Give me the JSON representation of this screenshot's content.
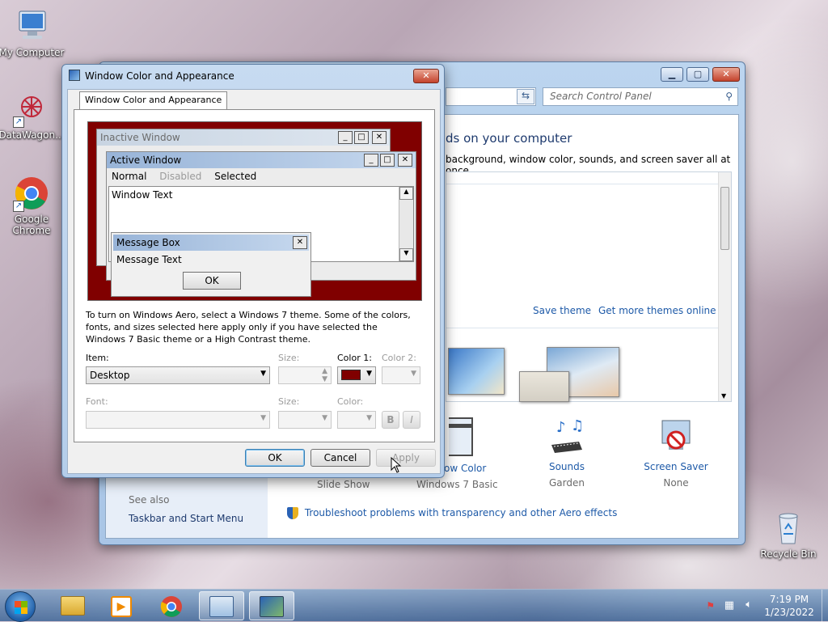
{
  "desktop": {
    "icons": [
      {
        "label": "My Computer"
      },
      {
        "label": "DataWagon..."
      },
      {
        "label": "Google Chrome"
      },
      {
        "label": "Recycle Bin"
      }
    ]
  },
  "control_panel": {
    "search_placeholder": "Search Control Panel",
    "heading": "ds on your computer",
    "subheading": "background, window color, sounds, and screen saver all at once.",
    "save_theme": "Save theme",
    "get_more_themes": "Get more themes online",
    "bottom_items": [
      {
        "title": "ow Color",
        "sub": "Windows 7 Basic"
      },
      {
        "title": "Sounds",
        "sub": "Garden"
      },
      {
        "title": "Screen Saver",
        "sub": "None"
      }
    ],
    "slide_show": "Slide Show",
    "see_also": "See also",
    "taskbar_link": "Taskbar and Start Menu",
    "troubleshoot": "Troubleshoot problems with transparency and other Aero effects"
  },
  "dialog": {
    "title": "Window Color and Appearance",
    "tab": "Window Color and Appearance",
    "preview": {
      "inactive_title": "Inactive Window",
      "active_title": "Active Window",
      "menu_normal": "Normal",
      "menu_disabled": "Disabled",
      "menu_selected": "Selected",
      "window_text": "Window Text",
      "msgbox_title": "Message Box",
      "msgbox_text": "Message Text",
      "msgbox_ok": "OK"
    },
    "info": "To turn on Windows Aero, select a Windows 7 theme.  Some of the colors, fonts, and sizes selected here apply only if you have selected the Windows 7 Basic theme or a High Contrast theme.",
    "item_label": "Item:",
    "item_value": "Desktop",
    "size_label": "Size:",
    "color1_label": "Color 1:",
    "color1_value": "#800000",
    "color2_label": "Color 2:",
    "font_label": "Font:",
    "font_size_label": "Size:",
    "font_color_label": "Color:",
    "bold_label": "B",
    "italic_label": "I",
    "ok": "OK",
    "cancel": "Cancel",
    "apply": "Apply"
  },
  "taskbar": {
    "time": "7:19 PM",
    "date": "1/23/2022"
  }
}
